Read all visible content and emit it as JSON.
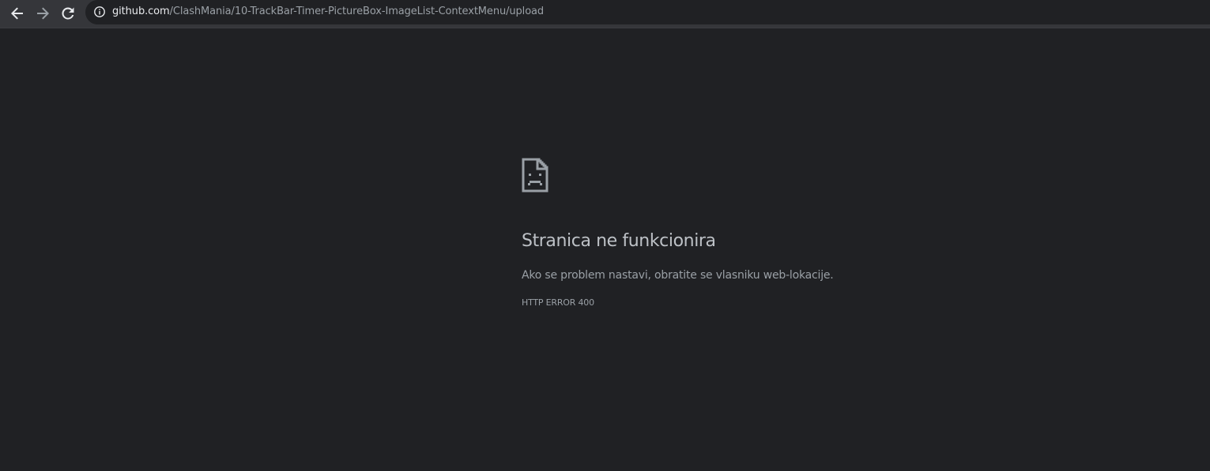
{
  "browser": {
    "url_host": "github.com",
    "url_path": "/ClashMania/10-TrackBar-Timer-PictureBox-ImageList-ContextMenu/upload",
    "icons": {
      "back": "arrow-left-icon",
      "forward": "arrow-right-icon",
      "reload": "reload-icon",
      "info": "info-icon"
    }
  },
  "error_page": {
    "icon": "sad-page-icon",
    "title": "Stranica ne funkcionira",
    "description": "Ako se problem nastavi, obratite se vlasniku web-lokacije.",
    "code": "HTTP ERROR 400"
  },
  "colors": {
    "background": "#202124",
    "toolbar": "#35363a",
    "text_primary": "#bdc1c6",
    "text_secondary": "#9aa0a6"
  }
}
